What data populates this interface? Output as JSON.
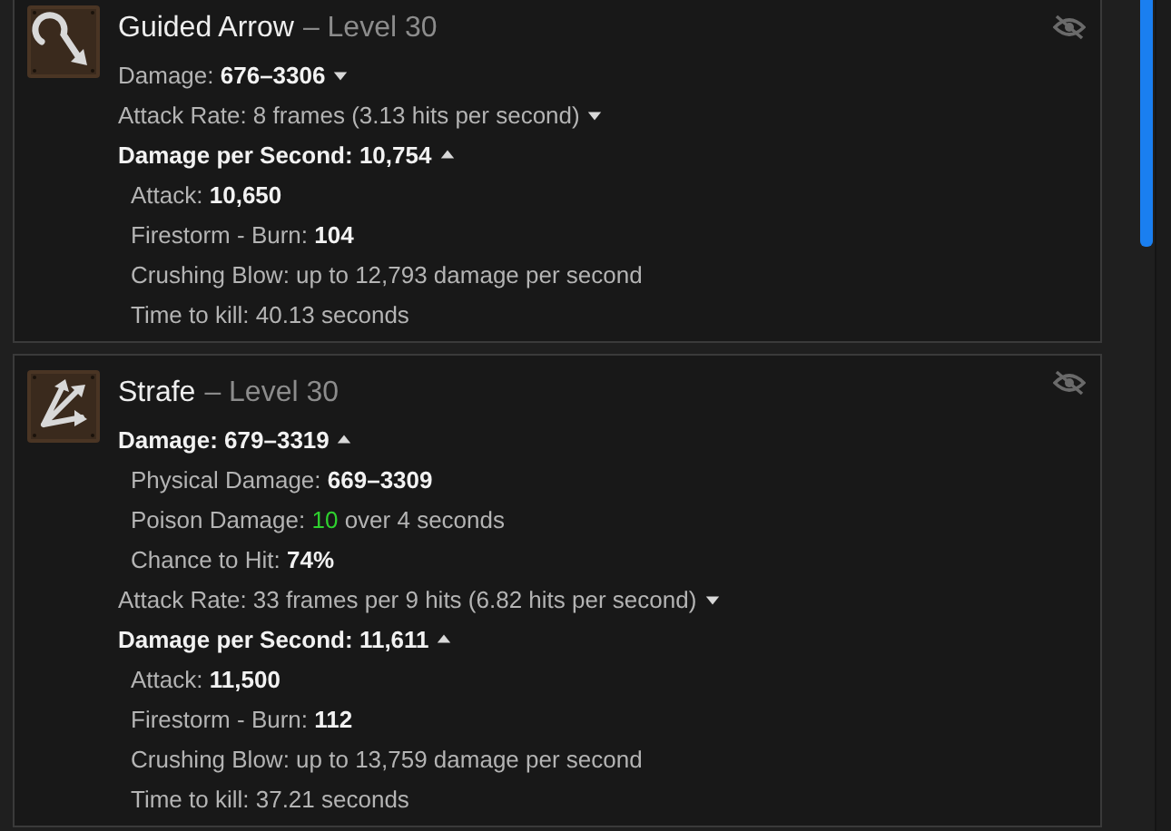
{
  "skills": [
    {
      "name": "Guided Arrow",
      "level": "– Level 30",
      "kind": "curve-arrow",
      "lines": [
        {
          "label": "Damage:",
          "value": "676–3306",
          "expanded": false
        },
        {
          "label": "Attack Rate: 8 frames (3.13 hits per second)",
          "expanded": false
        },
        {
          "label": "Damage per Second:",
          "value": "10,754",
          "expanded": true,
          "children": [
            {
              "label": "Attack:",
              "value": "10,650"
            },
            {
              "label": "Firestorm - Burn:",
              "value": "104"
            },
            {
              "label": "Crushing Blow: up to 12,793 damage per second"
            },
            {
              "label": "Time to kill: 40.13 seconds"
            }
          ]
        }
      ]
    },
    {
      "name": "Strafe",
      "level": "– Level 30",
      "kind": "split-arrows",
      "lines": [
        {
          "label": "Damage:",
          "value": "679–3319",
          "expanded": true,
          "children": [
            {
              "label": "Physical Damage:",
              "value": "669–3309"
            },
            {
              "label": "Poison Damage:",
              "value": "10",
              "kind": "poison",
              "suffix": "over 4 seconds"
            },
            {
              "label": "Chance to Hit:",
              "value": "74%"
            }
          ]
        },
        {
          "label": "Attack Rate: 33 frames per 9 hits (6.82 hits per second)",
          "expanded": false
        },
        {
          "label": "Damage per Second:",
          "value": "11,611",
          "expanded": true,
          "children": [
            {
              "label": "Attack:",
              "value": "11,500"
            },
            {
              "label": "Firestorm - Burn:",
              "value": "112"
            },
            {
              "label": "Crushing Blow: up to 13,759 damage per second"
            },
            {
              "label": "Time to kill: 37.21 seconds"
            }
          ]
        }
      ]
    }
  ]
}
